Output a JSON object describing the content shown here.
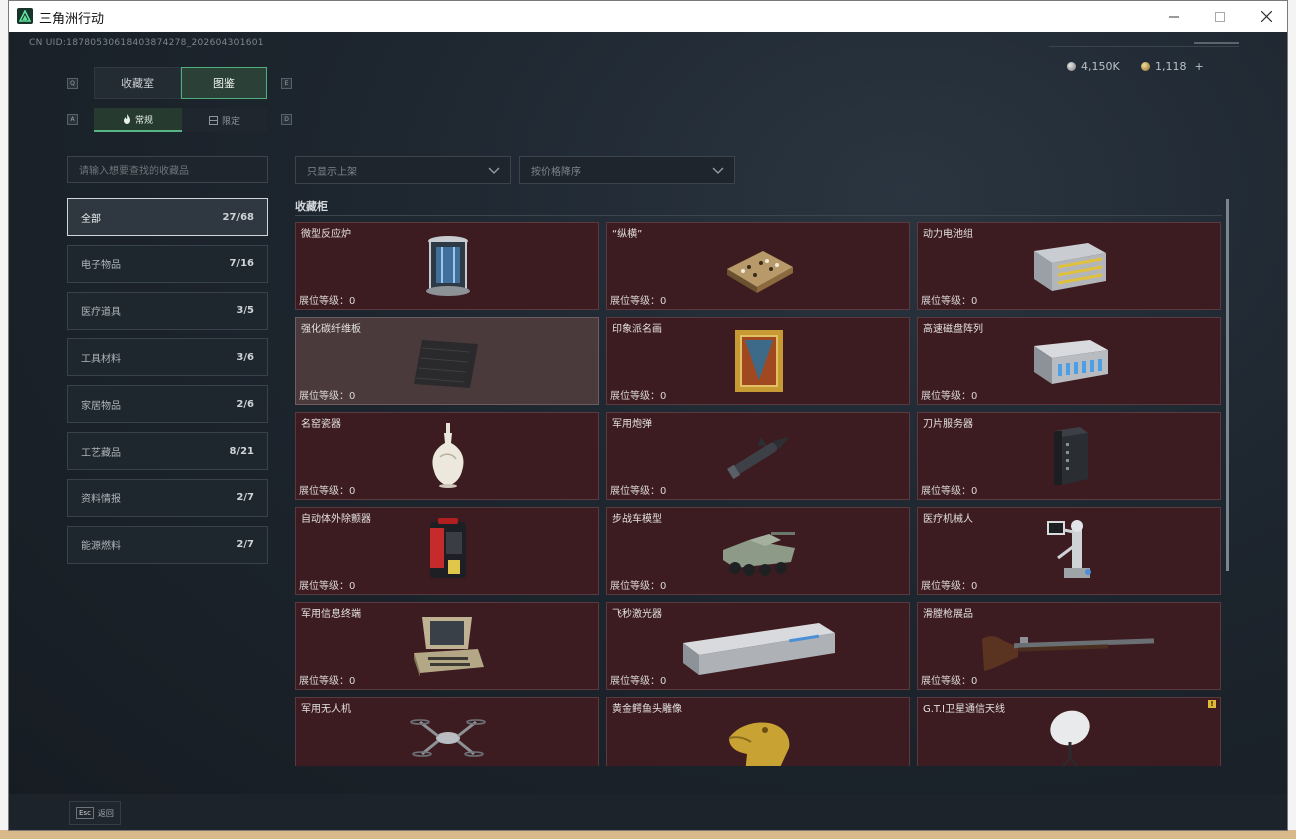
{
  "window": {
    "title": "三角洲行动"
  },
  "uid": "CN UID:18780530618403874278_202604301601",
  "currency": [
    {
      "icon": "silver-coin-icon",
      "value": "4,150K"
    },
    {
      "icon": "gold-coin-icon",
      "value": "1,118",
      "add": "+"
    }
  ],
  "key_hints": {
    "q": "Q",
    "e": "E",
    "a": "A",
    "d": "D"
  },
  "tabs_main": [
    {
      "label": "收藏室",
      "active": false
    },
    {
      "label": "图鉴",
      "active": true
    }
  ],
  "tabs_sub": [
    {
      "label": "常规",
      "icon": "flame-icon",
      "active": true
    },
    {
      "label": "限定",
      "icon": "box-icon",
      "active": false
    }
  ],
  "search": {
    "placeholder": "请输入想要查找的收藏品"
  },
  "filters": [
    {
      "value": "只显示上架"
    },
    {
      "value": "按价格降序"
    }
  ],
  "categories": [
    {
      "label": "全部",
      "count": "27/68",
      "active": true
    },
    {
      "label": "电子物品",
      "count": "7/16"
    },
    {
      "label": "医疗道具",
      "count": "3/5"
    },
    {
      "label": "工具材料",
      "count": "3/6"
    },
    {
      "label": "家居物品",
      "count": "2/6"
    },
    {
      "label": "工艺藏品",
      "count": "8/21"
    },
    {
      "label": "资料情报",
      "count": "2/7"
    },
    {
      "label": "能源燃料",
      "count": "2/7"
    }
  ],
  "section_title": "收藏柜",
  "level_label": "展位等级：0",
  "items": [
    {
      "name": "微型反应炉",
      "icon": "micro-reactor-icon"
    },
    {
      "name": "“纵横”",
      "icon": "chessboard-icon"
    },
    {
      "name": "动力电池组",
      "icon": "battery-pack-icon"
    },
    {
      "name": "强化碳纤维板",
      "icon": "carbon-plate-icon"
    },
    {
      "name": "印象派名画",
      "icon": "painting-icon"
    },
    {
      "name": "高速磁盘阵列",
      "icon": "disk-array-icon"
    },
    {
      "name": "名窑瓷器",
      "icon": "porcelain-vase-icon"
    },
    {
      "name": "军用炮弹",
      "icon": "artillery-shell-icon"
    },
    {
      "name": "刀片服务器",
      "icon": "blade-server-icon"
    },
    {
      "name": "自动体外除颤器",
      "icon": "defibrillator-icon"
    },
    {
      "name": "步战车模型",
      "icon": "ifv-model-icon"
    },
    {
      "name": "医疗机械人",
      "icon": "medical-robot-icon"
    },
    {
      "name": "军用信息终端",
      "icon": "military-terminal-icon"
    },
    {
      "name": "飞秒激光器",
      "icon": "femto-laser-icon"
    },
    {
      "name": "滑膛枪展品",
      "icon": "musket-icon"
    },
    {
      "name": "军用无人机",
      "icon": "drone-icon"
    },
    {
      "name": "黄金鳄鱼头雕像",
      "icon": "gold-crocodile-icon"
    },
    {
      "name": "G.T.I卫星通信天线",
      "icon": "satellite-dish-icon",
      "warning": "!"
    }
  ],
  "footer": {
    "esc_key": "Esc",
    "back_label": "返回"
  }
}
